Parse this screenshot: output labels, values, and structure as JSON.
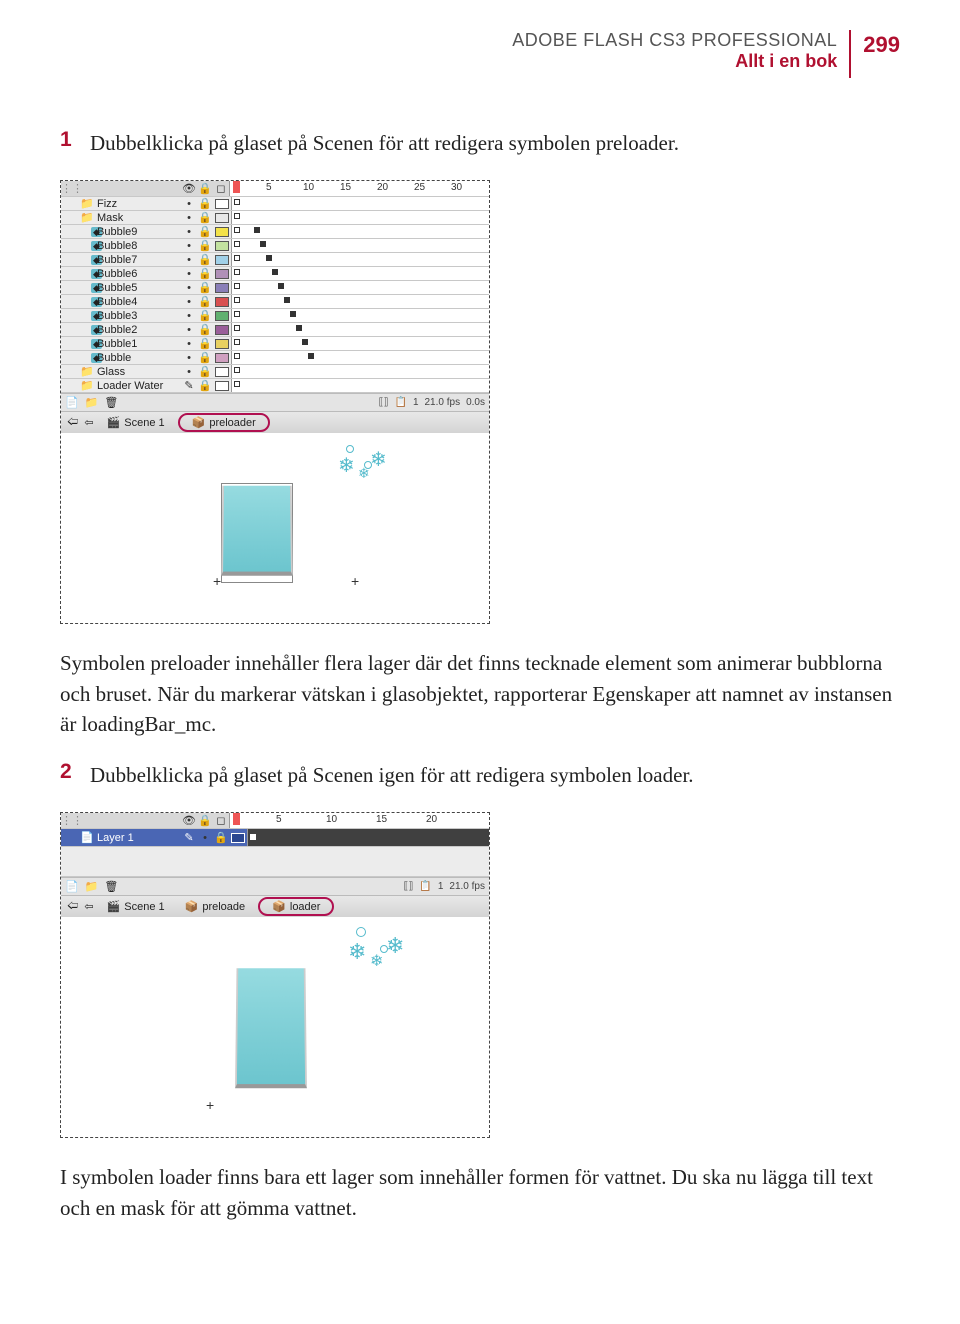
{
  "header": {
    "title": "ADOBE FLASH CS3 PROFESSIONAL",
    "subtitle": "Allt i en bok",
    "page": "299"
  },
  "step1_num": "1",
  "step1": "Dubbelklicka på glaset på Scenen för att redigera symbolen preloader.",
  "para1": "Symbolen preloader innehåller flera lager där det finns tecknade element som animerar bubblorna och bruset. När du markerar vätskan i glasobjektet, rapporterar Egenskaper att namnet av instansen är loadingBar_mc.",
  "step2_num": "2",
  "step2": "Dubbelklicka på glaset på Scenen igen för att redigera symbolen loader.",
  "para2": "I symbolen loader finns bara ett lager som innehåller formen för vattnet. Du ska nu lägga till text och en mask för att gömma vattnet.",
  "tl1": {
    "ticks": [
      "5",
      "10",
      "15",
      "20",
      "25",
      "30"
    ],
    "layers": [
      {
        "icon": "📁",
        "name": "Fizz",
        "sw": "#fff"
      },
      {
        "icon": "📁",
        "name": "Mask",
        "sw": "#e8e8e8"
      },
      {
        "icon": "💠",
        "name": "Bubble9",
        "sw": "#f3e24a"
      },
      {
        "icon": "💠",
        "name": "Bubble8",
        "sw": "#c3e2a0"
      },
      {
        "icon": "💠",
        "name": "Bubble7",
        "sw": "#a0d0e8"
      },
      {
        "icon": "💠",
        "name": "Bubble6",
        "sw": "#b090b8"
      },
      {
        "icon": "💠",
        "name": "Bubble5",
        "sw": "#8a7fb8"
      },
      {
        "icon": "💠",
        "name": "Bubble4",
        "sw": "#d85050"
      },
      {
        "icon": "💠",
        "name": "Bubble3",
        "sw": "#60b070"
      },
      {
        "icon": "💠",
        "name": "Bubble2",
        "sw": "#9a5f9a"
      },
      {
        "icon": "💠",
        "name": "Bubble1",
        "sw": "#e8d060"
      },
      {
        "icon": "💠",
        "name": "Bubble",
        "sw": "#d0a0c0"
      },
      {
        "icon": "📁",
        "name": "Glass",
        "sw": "#fff"
      },
      {
        "icon": "📁",
        "name": "Loader Water",
        "sw": "#fff",
        "pencil": true
      }
    ],
    "bottom": {
      "frame": "1",
      "fps": "21.0 fps",
      "time": "0.0s"
    },
    "crumb": {
      "scene": "Scene 1",
      "sym": "preloader"
    }
  },
  "tl2": {
    "ticks": [
      "5",
      "10",
      "15",
      "20"
    ],
    "layer": {
      "name": "Layer 1"
    },
    "bottom": {
      "frame": "1",
      "fps": "21.0 fps"
    },
    "crumb": {
      "scene": "Scene 1",
      "sym1": "preloade",
      "sym2": "loader"
    }
  }
}
